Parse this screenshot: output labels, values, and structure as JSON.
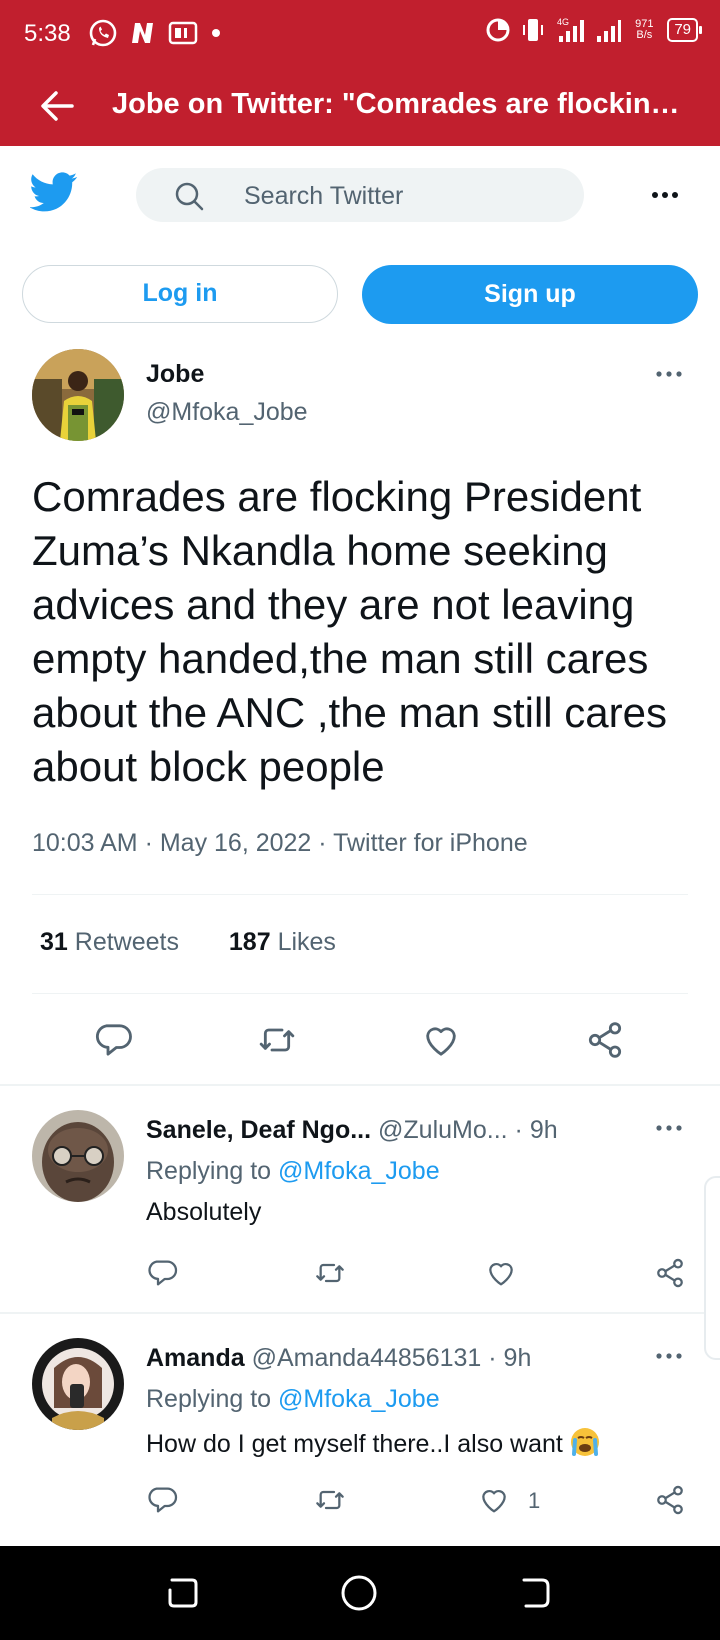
{
  "status_bar": {
    "time": "5:38",
    "network": "4G",
    "speed": "971 B/s",
    "battery": "79"
  },
  "browser": {
    "page_title": "Jobe on Twitter: \"Comrades are flocking P..."
  },
  "header": {
    "search_placeholder": "Search Twitter",
    "login_label": "Log in",
    "signup_label": "Sign up"
  },
  "tweet": {
    "author_name": "Jobe",
    "author_handle": "@Mfoka_Jobe",
    "text": "Comrades are flocking President Zuma’s Nkandla home seeking advices and they are not leaving empty handed,the man still cares about the ANC ,the man still cares about block people",
    "meta": "10:03 AM · May 16, 2022 · Twitter for iPhone",
    "retweets": "31",
    "retweets_label": "Retweets",
    "likes": "187",
    "likes_label": "Likes"
  },
  "replies": [
    {
      "name": "Sanele, Deaf Ngo...",
      "handle": "@ZuluMo...",
      "time": "· 9h",
      "replying_prefix": "Replying to",
      "replying_to": "@Mfoka_Jobe",
      "text": "Absolutely",
      "likes": ""
    },
    {
      "name": "Amanda",
      "handle": "@Amanda44856131",
      "time": "· 9h",
      "replying_prefix": "Replying to",
      "replying_to": "@Mfoka_Jobe",
      "text": "How do I get myself there..I also want",
      "likes": "1"
    }
  ],
  "colors": {
    "chrome_red": "#c11f2e",
    "twitter_blue": "#1d9bf0",
    "text_primary": "#0f1419",
    "text_secondary": "#536471"
  }
}
